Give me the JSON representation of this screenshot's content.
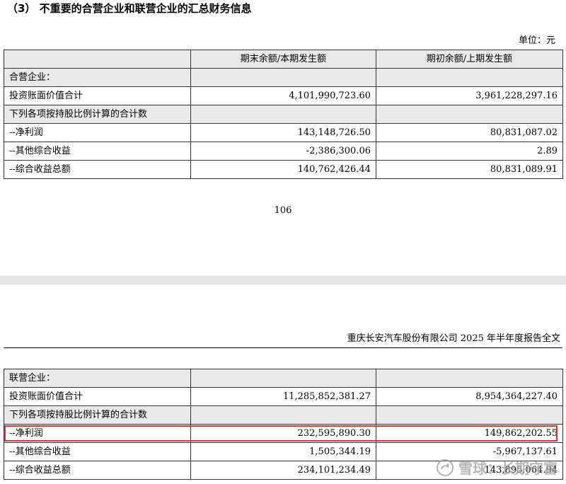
{
  "section_title": "（3） 不重要的合营企业和联营企业的汇总财务信息",
  "unit_label": "单位：元",
  "columns": [
    "",
    "期末余额/本期发生额",
    "期初余额/上期发生额"
  ],
  "jv_rows": [
    {
      "label": "合营企业：",
      "current": "",
      "prior": ""
    },
    {
      "label": "投资账面价值合计",
      "current": "4,101,990,723.60",
      "prior": "3,961,228,297.16"
    },
    {
      "label": "下列各项按持股比例计算的合计数",
      "current": "",
      "prior": ""
    },
    {
      "label": "--净利润",
      "current": "143,148,726.50",
      "prior": "80,831,087.02"
    },
    {
      "label": "--其他综合收益",
      "current": "-2,386,300.06",
      "prior": "2.89"
    },
    {
      "label": "--综合收益总额",
      "current": "140,762,426.44",
      "prior": "80,831,089.91"
    }
  ],
  "page_number": "106",
  "page_header": "重庆长安汽车股份有限公司 2025 年半年度报告全文",
  "assoc_rows": [
    {
      "label": "联营企业：",
      "current": "",
      "prior": ""
    },
    {
      "label": "投资账面价值合计",
      "current": "11,285,852,381.27",
      "prior": "8,954,364,227.40"
    },
    {
      "label": "下列各项按持股比例计算的合计数",
      "current": "",
      "prior": ""
    },
    {
      "label": "--净利润",
      "current": "232,595,890.30",
      "prior": "149,862,202.55"
    },
    {
      "label": "--其他综合收益",
      "current": "1,505,344.19",
      "prior": "-5,967,137.61"
    },
    {
      "label": "--综合收益总额",
      "current": "234,101,234.49",
      "prior": "143,895,064.94"
    }
  ],
  "highlight_color": "#e03030",
  "watermark": {
    "icon": "snowball-logo-icon",
    "text": "雪球：长期守富"
  }
}
